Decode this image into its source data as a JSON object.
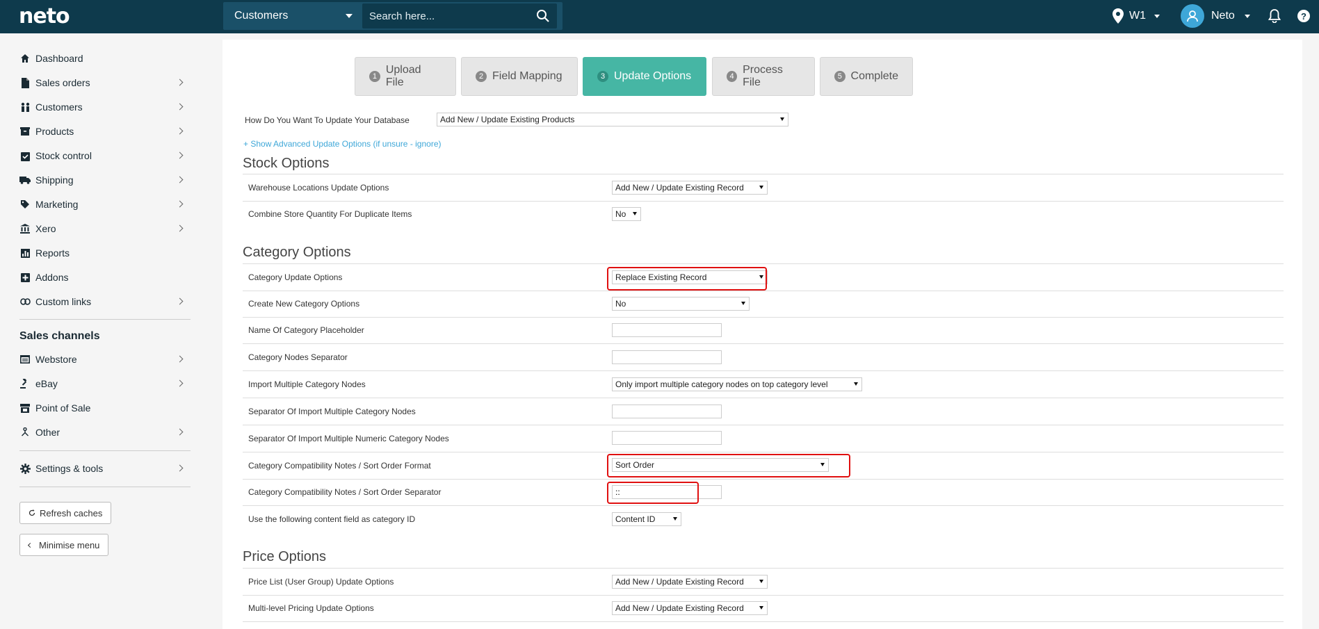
{
  "app": {
    "logo": "neto"
  },
  "header": {
    "module": "Customers",
    "search_placeholder": "Search here...",
    "location": "W1",
    "user_name": "Neto",
    "help_icon": "?"
  },
  "sidebar": {
    "items": [
      {
        "label": "Dashboard",
        "icon": "home-icon"
      },
      {
        "label": "Sales orders",
        "icon": "document-icon"
      },
      {
        "label": "Customers",
        "icon": "users-icon"
      },
      {
        "label": "Products",
        "icon": "box-icon"
      },
      {
        "label": "Stock control",
        "icon": "clipboard-check-icon"
      },
      {
        "label": "Shipping",
        "icon": "truck-icon"
      },
      {
        "label": "Marketing",
        "icon": "tag-icon"
      },
      {
        "label": "Xero",
        "icon": "bank-icon"
      },
      {
        "label": "Reports",
        "icon": "bar-chart-icon"
      },
      {
        "label": "Addons",
        "icon": "plus-square-icon"
      },
      {
        "label": "Custom links",
        "icon": "link-icon"
      }
    ],
    "sales_channels_heading": "Sales channels",
    "channels": [
      {
        "label": "Webstore",
        "icon": "window-icon"
      },
      {
        "label": "eBay",
        "icon": "gavel-icon"
      },
      {
        "label": "Point of Sale",
        "icon": "store-icon"
      },
      {
        "label": "Other",
        "icon": "sitemap-icon"
      }
    ],
    "settings_label": "Settings & tools",
    "refresh_label": "Refresh caches",
    "minimise_label": "Minimise menu"
  },
  "steps": [
    {
      "num": "1",
      "label": "Upload File"
    },
    {
      "num": "2",
      "label": "Field Mapping"
    },
    {
      "num": "3",
      "label": "Update Options"
    },
    {
      "num": "4",
      "label": "Process File"
    },
    {
      "num": "5",
      "label": "Complete"
    }
  ],
  "update_db": {
    "label": "How Do You Want To Update Your Database",
    "value": "Add New / Update Existing Products"
  },
  "advanced_link": "+ Show Advanced Update Options (if unsure - ignore)",
  "stock_options": {
    "title": "Stock Options",
    "rows": [
      {
        "label": "Warehouse Locations Update Options",
        "value": "Add New / Update Existing Record"
      },
      {
        "label": "Combine Store Quantity For Duplicate Items",
        "value": "No"
      }
    ]
  },
  "category_options": {
    "title": "Category Options",
    "rows": [
      {
        "label": "Category Update Options",
        "value": "Replace Existing Record"
      },
      {
        "label": "Create New Category Options",
        "value": "No"
      },
      {
        "label": "Name Of Category Placeholder",
        "value": ""
      },
      {
        "label": "Category Nodes Separator",
        "value": ""
      },
      {
        "label": "Import Multiple Category Nodes",
        "value": "Only import multiple category nodes on top category level"
      },
      {
        "label": "Separator Of Import Multiple Category Nodes",
        "value": ""
      },
      {
        "label": "Separator Of Import Multiple Numeric Category Nodes",
        "value": ""
      },
      {
        "label": "Category Compatibility Notes / Sort Order Format",
        "value": "Sort Order"
      },
      {
        "label": "Category Compatibility Notes / Sort Order Separator",
        "value": "::"
      },
      {
        "label": "Use the following content field as category ID",
        "value": "Content ID"
      }
    ]
  },
  "price_options": {
    "title": "Price Options",
    "rows": [
      {
        "label": "Price List (User Group) Update Options",
        "value": "Add New / Update Existing Record"
      },
      {
        "label": "Multi-level Pricing Update Options",
        "value": "Add New / Update Existing Record"
      }
    ]
  },
  "colors": {
    "topbar": "#0e3a4c",
    "active_step": "#46b6a4",
    "link": "#3ea7d8",
    "highlight": "#e01010"
  }
}
